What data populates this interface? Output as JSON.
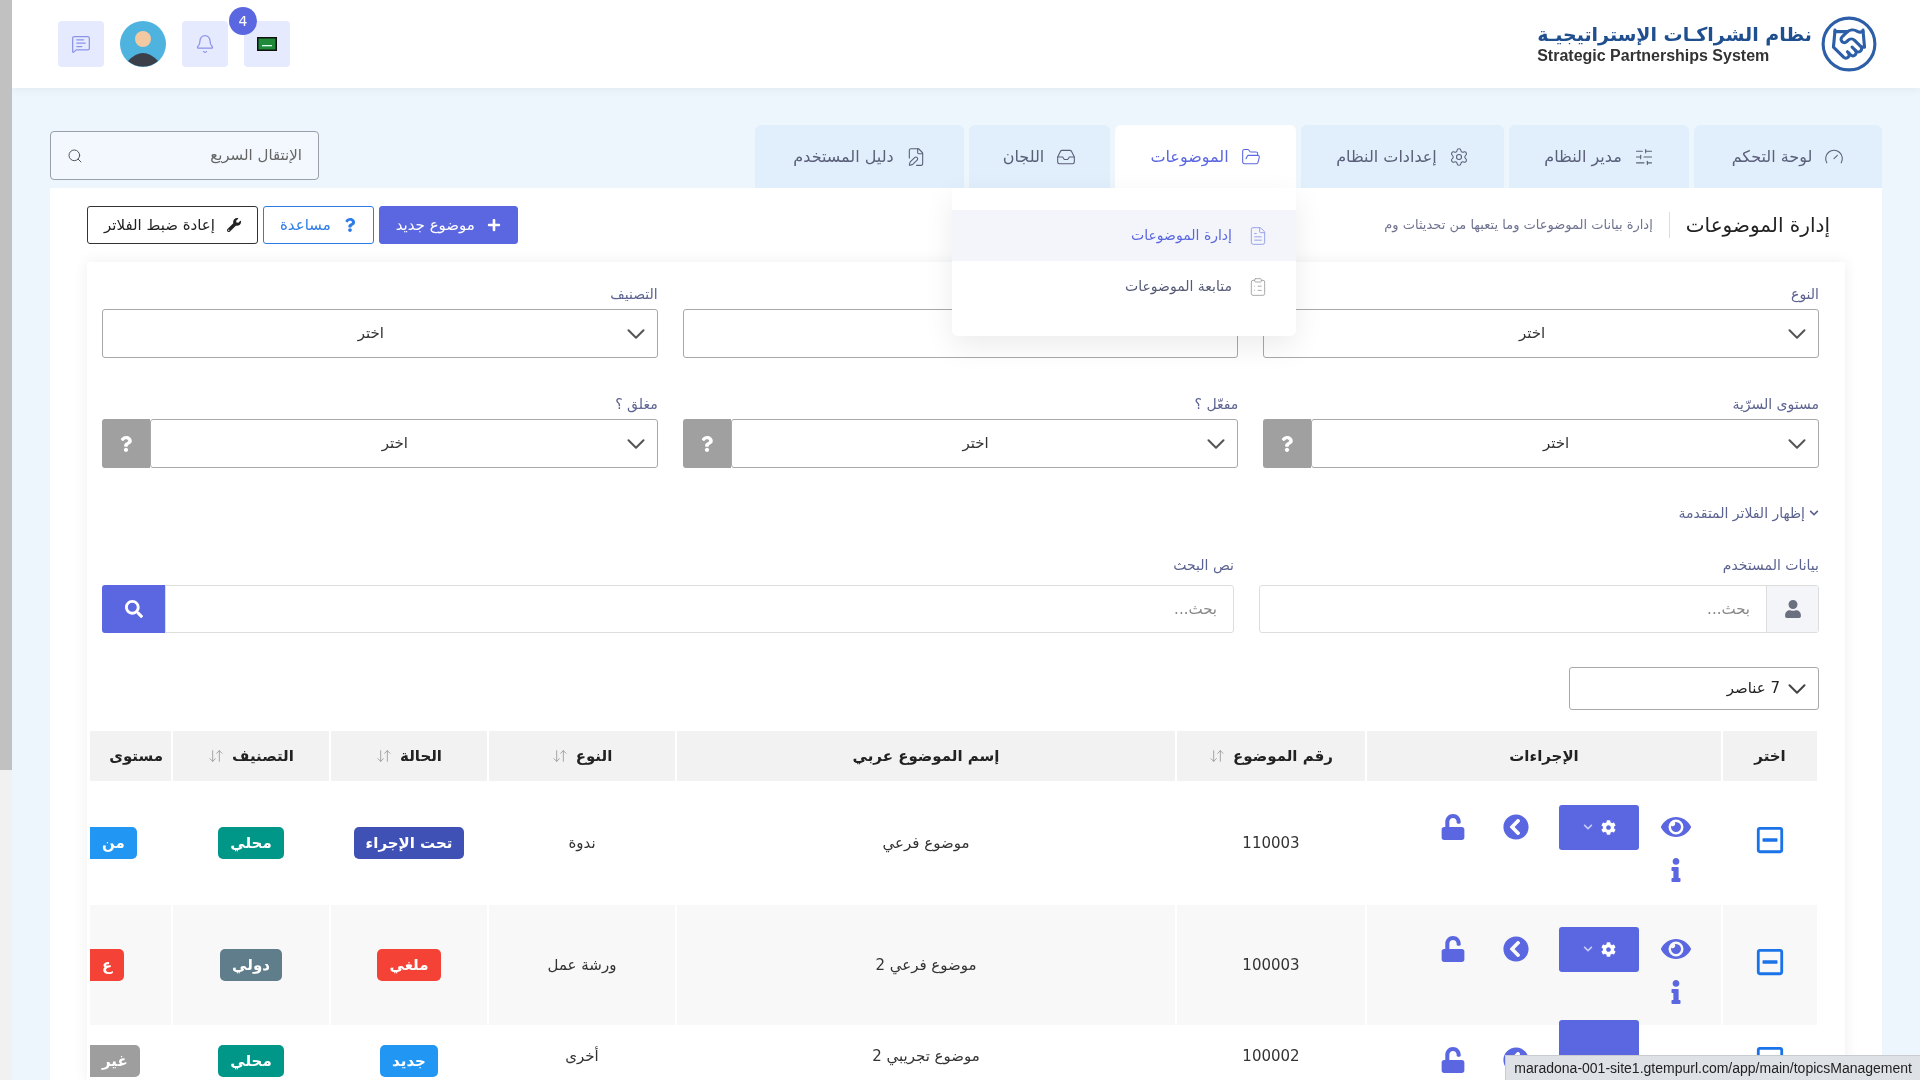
{
  "header": {
    "logo_title": "نظام الشراكـات الإستراتيجيـة",
    "logo_subtitle": "Strategic Partnerships System",
    "notification_count": "4"
  },
  "tabs": [
    {
      "label": "لوحة التحكم",
      "selected": false
    },
    {
      "label": "مدير النظام",
      "selected": false
    },
    {
      "label": "إعدادات النظام",
      "selected": false
    },
    {
      "label": "الموضوعات",
      "selected": true
    },
    {
      "label": "اللجان",
      "selected": false
    },
    {
      "label": "دليل المستخدم",
      "selected": false
    }
  ],
  "topics_menu": [
    {
      "label": "إدارة الموضوعات",
      "selected": true
    },
    {
      "label": "متابعة الموضوعات",
      "selected": false
    }
  ],
  "quick_search": {
    "placeholder": "الإنتقال السريع"
  },
  "page": {
    "title": "إدارة الموضوعات",
    "subtitle": "إدارة بيانات الموضوعات وما يتعبها من تحديثات وم"
  },
  "buttons": [
    {
      "label": "موضوع جديد",
      "kind": "primary"
    },
    {
      "label": "مساعدة",
      "kind": "outline"
    },
    {
      "label": "إعادة ضبط الفلاتر",
      "kind": "dark"
    }
  ],
  "filters": [
    {
      "label": "النوع",
      "value": "اختر",
      "help": false
    },
    {
      "help": false
    },
    {
      "label": "التصنيف",
      "value": "اختر",
      "help": false
    },
    {
      "label": "مستوى السرّية",
      "value": "اختر",
      "help": true
    },
    {
      "label": "مفعّل ؟",
      "value": "اختر",
      "help": true
    },
    {
      "label": "مغلق ؟",
      "value": "اختر",
      "help": true
    }
  ],
  "advanced_toggle": "إظهار الفلاتر المتقدمة",
  "user_search": {
    "label": "بيانات المستخدم",
    "placeholder": "بحث..."
  },
  "text_search": {
    "label": "نص البحث",
    "placeholder": "بحث..."
  },
  "page_size": "7 عناصر",
  "table": {
    "columns": [
      {
        "label": "اختر",
        "sortable": false
      },
      {
        "label": "الإجراءات",
        "sortable": false
      },
      {
        "label": "رقم الموضوع",
        "sortable": true
      },
      {
        "label": "إسم الموضوع عربي",
        "sortable": false
      },
      {
        "label": "النوع",
        "sortable": true
      },
      {
        "label": "الحالة",
        "sortable": true
      },
      {
        "label": "التصنيف",
        "sortable": true
      },
      {
        "label": "مستوى",
        "sortable": false
      }
    ],
    "rows": [
      {
        "number": "110003",
        "name": "موضوع فرعي",
        "type": "ندوة",
        "status": {
          "text": "تحت الإجراء",
          "color": "#3f51b5"
        },
        "classification": {
          "text": "محلي",
          "color": "#009688"
        },
        "level": {
          "text": "من",
          "color": "#2196f3"
        }
      },
      {
        "number": "100003",
        "name": "موضوع فرعي 2",
        "type": "ورشة عمل",
        "status": {
          "text": "ملغي",
          "color": "#f44336"
        },
        "classification": {
          "text": "دولي",
          "color": "#607d8b"
        },
        "level": {
          "text": "ع",
          "color": "#f44336"
        }
      },
      {
        "number": "100002",
        "name": "موضوع تجريبي 2",
        "type": "أخرى",
        "status": {
          "text": "جديد",
          "color": "#2196f3"
        },
        "classification": {
          "text": "محلي",
          "color": "#009688"
        },
        "level": {
          "text": "غير",
          "color": "#9e9e9e"
        }
      }
    ]
  },
  "status_bar": "maradona-001-site1.gtempurl.com/app/main/topicsManagement"
}
